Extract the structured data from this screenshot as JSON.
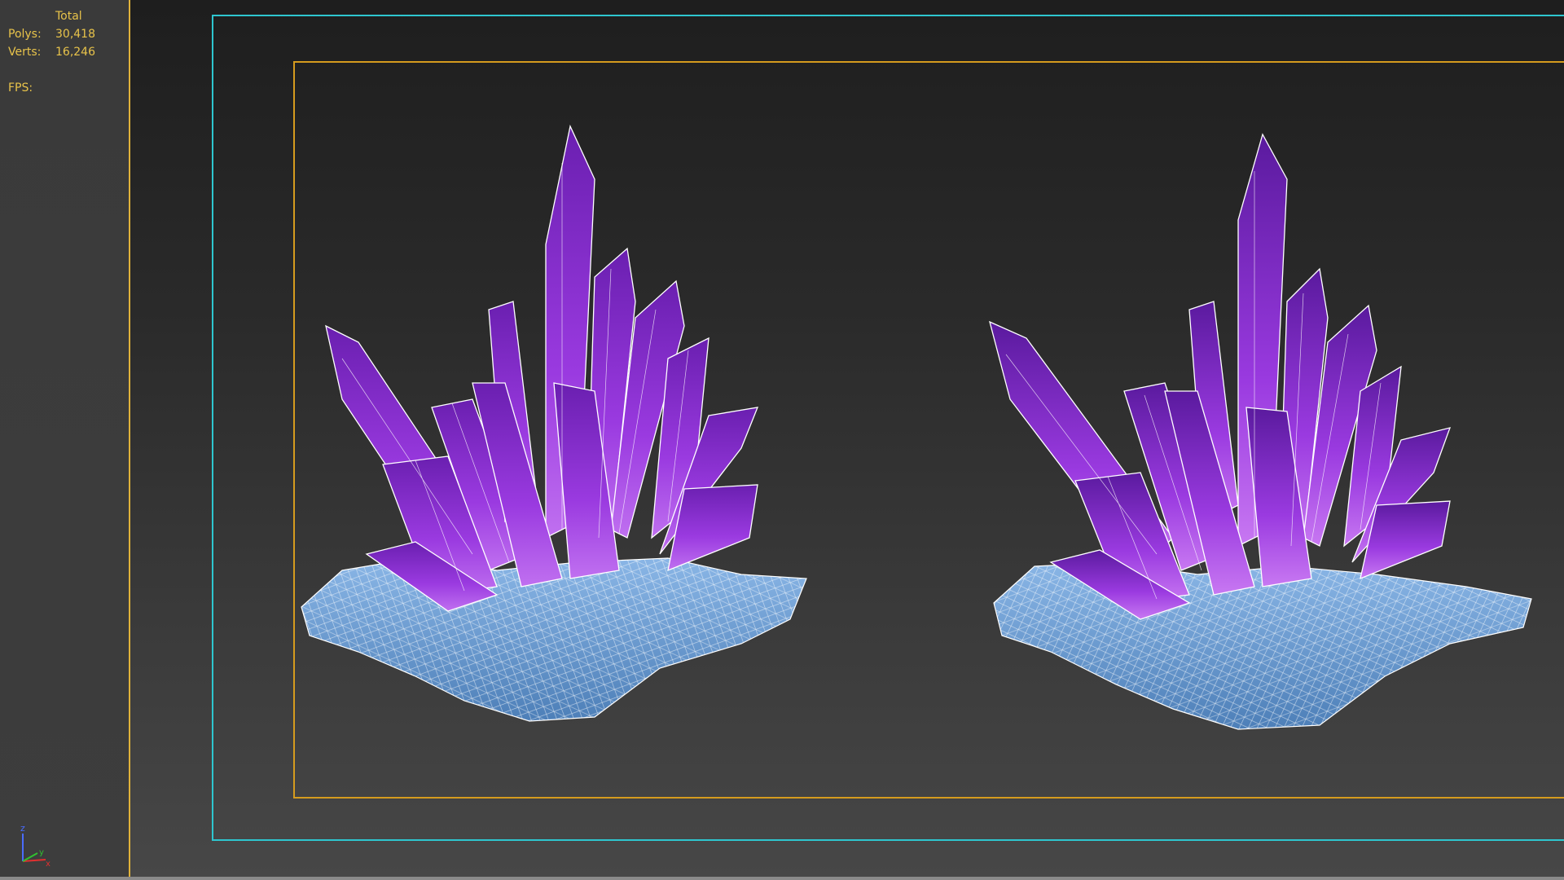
{
  "stats": {
    "header": "Total",
    "polys_label": "Polys:",
    "polys_value": "30,418",
    "verts_label": "Verts:",
    "verts_value": "16,246",
    "fps_label": "FPS:"
  },
  "gizmo": {
    "z_label": "z",
    "x_label": "x",
    "y_label": "y"
  },
  "colors": {
    "stats_text": "#e8c34a",
    "safe_frame_outer": "#2ec6cf",
    "safe_frame_inner": "#d59b1e",
    "crystal_purple": "#8a2ecf",
    "rock_blue": "#6f9ed0",
    "wireframe": "#ffffff"
  },
  "viewport": {
    "objects": [
      "crystal-cluster",
      "crystal-cluster"
    ]
  }
}
